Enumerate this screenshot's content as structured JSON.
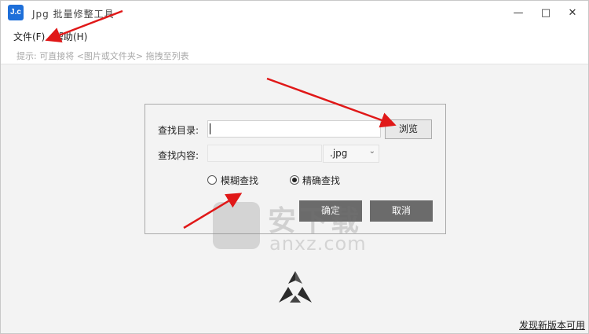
{
  "window": {
    "app_icon_text": "J.c",
    "title": "Jpg 批量修整工具",
    "minimize_label": "—",
    "maximize_label": "□",
    "close_label": "✕"
  },
  "menu": {
    "items": [
      {
        "label": "文件(F)"
      },
      {
        "label": "帮助(H)"
      }
    ]
  },
  "hint": "提示: 可直接将 <图片或文件夹> 拖拽至列表",
  "dialog": {
    "dir_label": "查找目录:",
    "dir_value": "",
    "browse_label": "浏览",
    "content_label": "查找内容:",
    "content_value": "",
    "ext_value": ".jpg",
    "radio_fuzzy": "模糊查找",
    "radio_exact": "精确查找",
    "selected_mode": "exact",
    "ok_label": "确定",
    "cancel_label": "取消"
  },
  "footer": {
    "update_link": "发现新版本可用"
  },
  "watermark": {
    "text": "安下载",
    "sub": "anxz.com"
  },
  "colors": {
    "accent": "#1e6fd9",
    "button": "#6b6b6b",
    "arrow": "#e01818"
  }
}
